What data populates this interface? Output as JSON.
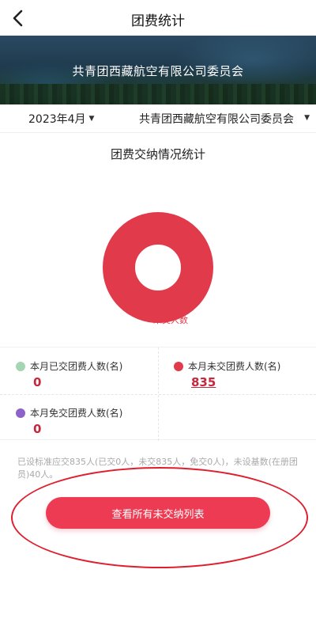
{
  "nav": {
    "title": "团费统计",
    "back_icon": "chevron-left-icon"
  },
  "banner": {
    "title": "共青团西藏航空有限公司委员会"
  },
  "filters": {
    "month": "2023年4月",
    "organization": "共青团西藏航空有限公司委员会"
  },
  "section": {
    "title": "团费交纳情况统计"
  },
  "chart_data": {
    "type": "pie",
    "style": "donut",
    "categories": [
      "本月已交团费人数(名)",
      "本月未交团费人数(名)",
      "本月免交团费人数(名)"
    ],
    "values": [
      0,
      835,
      0
    ],
    "colors": [
      "#a6d5b3",
      "#e13a4a",
      "#8e63c7"
    ],
    "annotation_label": "未交人数",
    "legend": "bottom"
  },
  "stats": [
    {
      "label": "本月已交团费人数(名)",
      "value": "0",
      "color": "#a6d5b3"
    },
    {
      "label": "本月未交团费人数(名)",
      "value": "835",
      "color": "#e13a4a"
    },
    {
      "label": "本月免交团费人数(名)",
      "value": "0",
      "color": "#8e63c7"
    }
  ],
  "note": "已设标准应交835人(已交0人，未交835人，免交0人)，未设基数(在册团员)40人。",
  "action": {
    "label": "查看所有未交纳列表"
  }
}
